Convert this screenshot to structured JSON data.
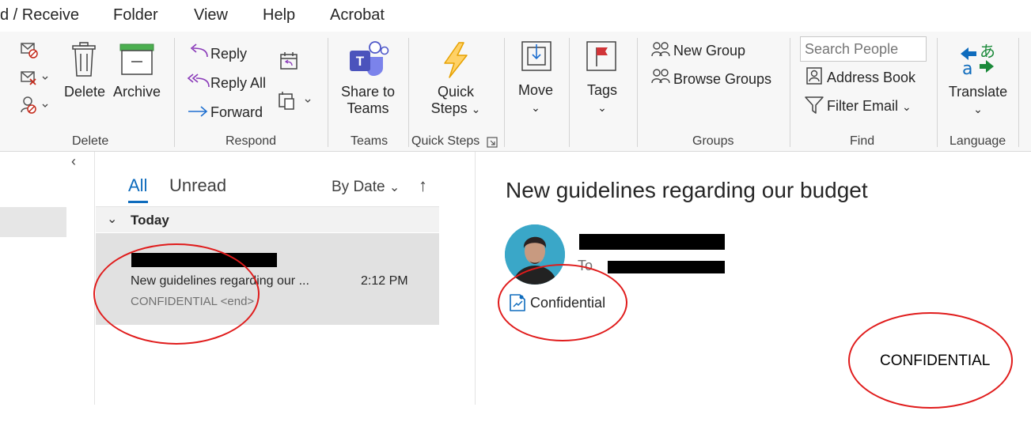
{
  "menu": {
    "items": [
      "d / Receive",
      "Folder",
      "View",
      "Help",
      "Acrobat"
    ]
  },
  "ribbon": {
    "delete_group": {
      "delete_label": "Delete",
      "archive_label": "Archive",
      "group_label": "Delete"
    },
    "respond_group": {
      "reply_label": "Reply",
      "reply_all_label": "Reply All",
      "forward_label": "Forward",
      "group_label": "Respond"
    },
    "teams_group": {
      "share_line1": "Share to",
      "share_line2": "Teams",
      "group_label": "Teams"
    },
    "quicksteps_group": {
      "line1": "Quick",
      "line2": "Steps",
      "group_label": "Quick Steps"
    },
    "move_label": "Move",
    "tags_label": "Tags",
    "groups_group": {
      "new_group_label": "New Group",
      "browse_groups_label": "Browse Groups",
      "group_label": "Groups"
    },
    "find_group": {
      "search_placeholder": "Search People",
      "address_book_label": "Address Book",
      "filter_email_label": "Filter Email",
      "group_label": "Find"
    },
    "language_group": {
      "translate_label": "Translate",
      "group_label": "Language"
    }
  },
  "message_list": {
    "tabs": [
      "All",
      "Unread"
    ],
    "active_tab": "All",
    "sort_label": "By Date",
    "group_header": "Today",
    "messages": [
      {
        "subject": "New guidelines regarding our ...",
        "time": "2:12 PM",
        "preview": "CONFIDENTIAL <end>"
      }
    ]
  },
  "reading_pane": {
    "subject": "New guidelines regarding our budget",
    "to_label": "To",
    "sensitivity_label": "Confidential",
    "body_text": "CONFIDENTIAL"
  },
  "colors": {
    "accent": "#0f6cbd",
    "annotation": "#e01b1b",
    "selected_row": "#e1e1e1",
    "ribbon_bg": "#f7f7f7"
  }
}
